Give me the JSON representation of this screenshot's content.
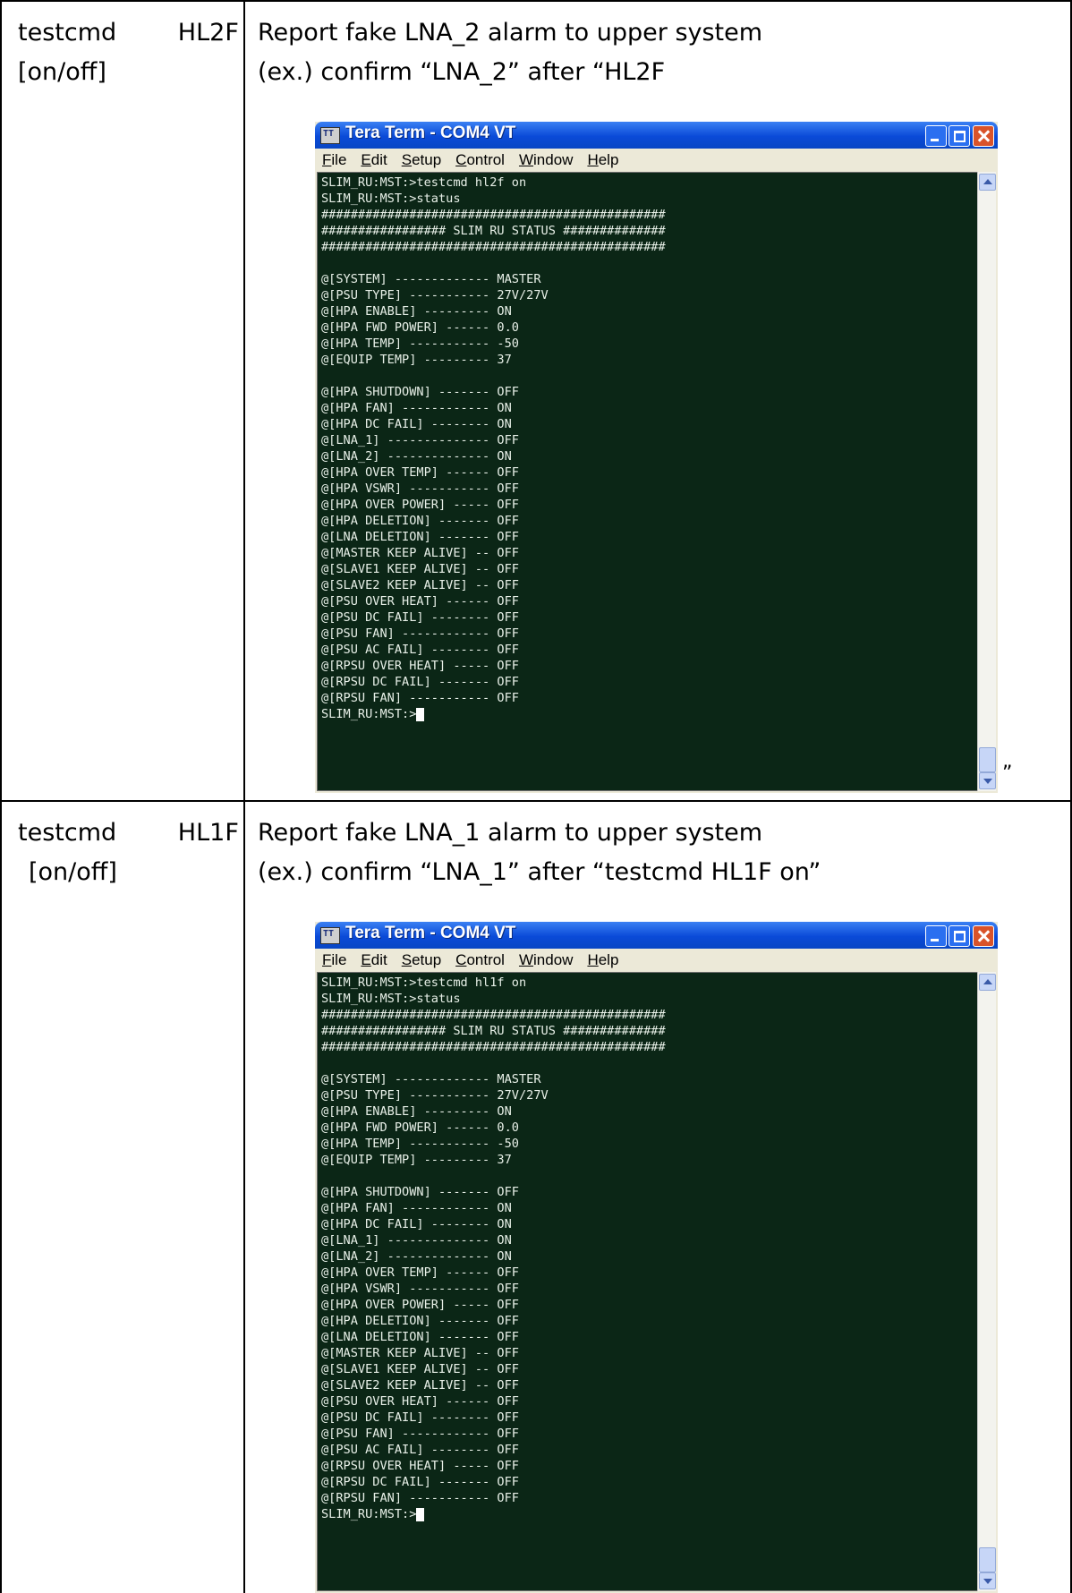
{
  "rows": [
    {
      "command": "testcmd        HL2F",
      "command_args": "[on/off]",
      "description": "Report fake LNA_2 alarm to upper system",
      "example": "(ex.) confirm “LNA_2” after “HL2F",
      "trailing_quote": "”",
      "terminal": {
        "title": "Tera Term - COM4 VT",
        "menu": [
          "File",
          "Edit",
          "Setup",
          "Control",
          "Window",
          "Help"
        ],
        "screen_text": "SLIM_RU:MST:>testcmd hl2f on\nSLIM_RU:MST:>status\n###############################################\n################# SLIM RU STATUS ##############\n###############################################\n\n@[SYSTEM] ------------- MASTER\n@[PSU TYPE] ----------- 27V/27V\n@[HPA ENABLE] --------- ON\n@[HPA FWD POWER] ------ 0.0\n@[HPA TEMP] ----------- -50\n@[EQUIP TEMP] --------- 37\n\n@[HPA SHUTDOWN] ------- OFF\n@[HPA FAN] ------------ ON\n@[HPA DC FAIL] -------- ON\n@[LNA_1] -------------- OFF\n@[LNA_2] -------------- ON\n@[HPA OVER TEMP] ------ OFF\n@[HPA VSWR] ----------- OFF\n@[HPA OVER POWER] ----- OFF\n@[HPA DELETION] ------- OFF\n@[LNA DELETION] ------- OFF\n@[MASTER KEEP ALIVE] -- OFF\n@[SLAVE1 KEEP ALIVE] -- OFF\n@[SLAVE2 KEEP ALIVE] -- OFF\n@[PSU OVER HEAT] ------ OFF\n@[PSU DC FAIL] -------- OFF\n@[PSU FAN] ------------ OFF\n@[PSU AC FAIL] -------- OFF\n@[RPSU OVER HEAT] ----- OFF\n@[RPSU DC FAIL] ------- OFF\n@[RPSU FAN] ----------- OFF",
        "prompt": "SLIM_RU:MST:>"
      }
    },
    {
      "command": "testcmd        HL1F",
      "command_args": "[on/off]",
      "description": "Report fake LNA_1 alarm to upper system",
      "example": "(ex.) confirm “LNA_1” after “testcmd HL1F on”",
      "terminal": {
        "title": "Tera Term - COM4 VT",
        "menu": [
          "File",
          "Edit",
          "Setup",
          "Control",
          "Window",
          "Help"
        ],
        "screen_text": "SLIM_RU:MST:>testcmd hl1f on\nSLIM_RU:MST:>status\n###############################################\n################# SLIM RU STATUS ##############\n###############################################\n\n@[SYSTEM] ------------- MASTER\n@[PSU TYPE] ----------- 27V/27V\n@[HPA ENABLE] --------- ON\n@[HPA FWD POWER] ------ 0.0\n@[HPA TEMP] ----------- -50\n@[EQUIP TEMP] --------- 37\n\n@[HPA SHUTDOWN] ------- OFF\n@[HPA FAN] ------------ ON\n@[HPA DC FAIL] -------- ON\n@[LNA_1] -------------- ON\n@[LNA_2] -------------- ON\n@[HPA OVER TEMP] ------ OFF\n@[HPA VSWR] ----------- OFF\n@[HPA OVER POWER] ----- OFF\n@[HPA DELETION] ------- OFF\n@[LNA DELETION] ------- OFF\n@[MASTER KEEP ALIVE] -- OFF\n@[SLAVE1 KEEP ALIVE] -- OFF\n@[SLAVE2 KEEP ALIVE] -- OFF\n@[PSU OVER HEAT] ------ OFF\n@[PSU DC FAIL] -------- OFF\n@[PSU FAN] ------------ OFF\n@[PSU AC FAIL] -------- OFF\n@[RPSU OVER HEAT] ----- OFF\n@[RPSU DC FAIL] ------- OFF\n@[RPSU FAN] ----------- OFF",
        "prompt": "SLIM_RU:MST:>"
      }
    }
  ]
}
